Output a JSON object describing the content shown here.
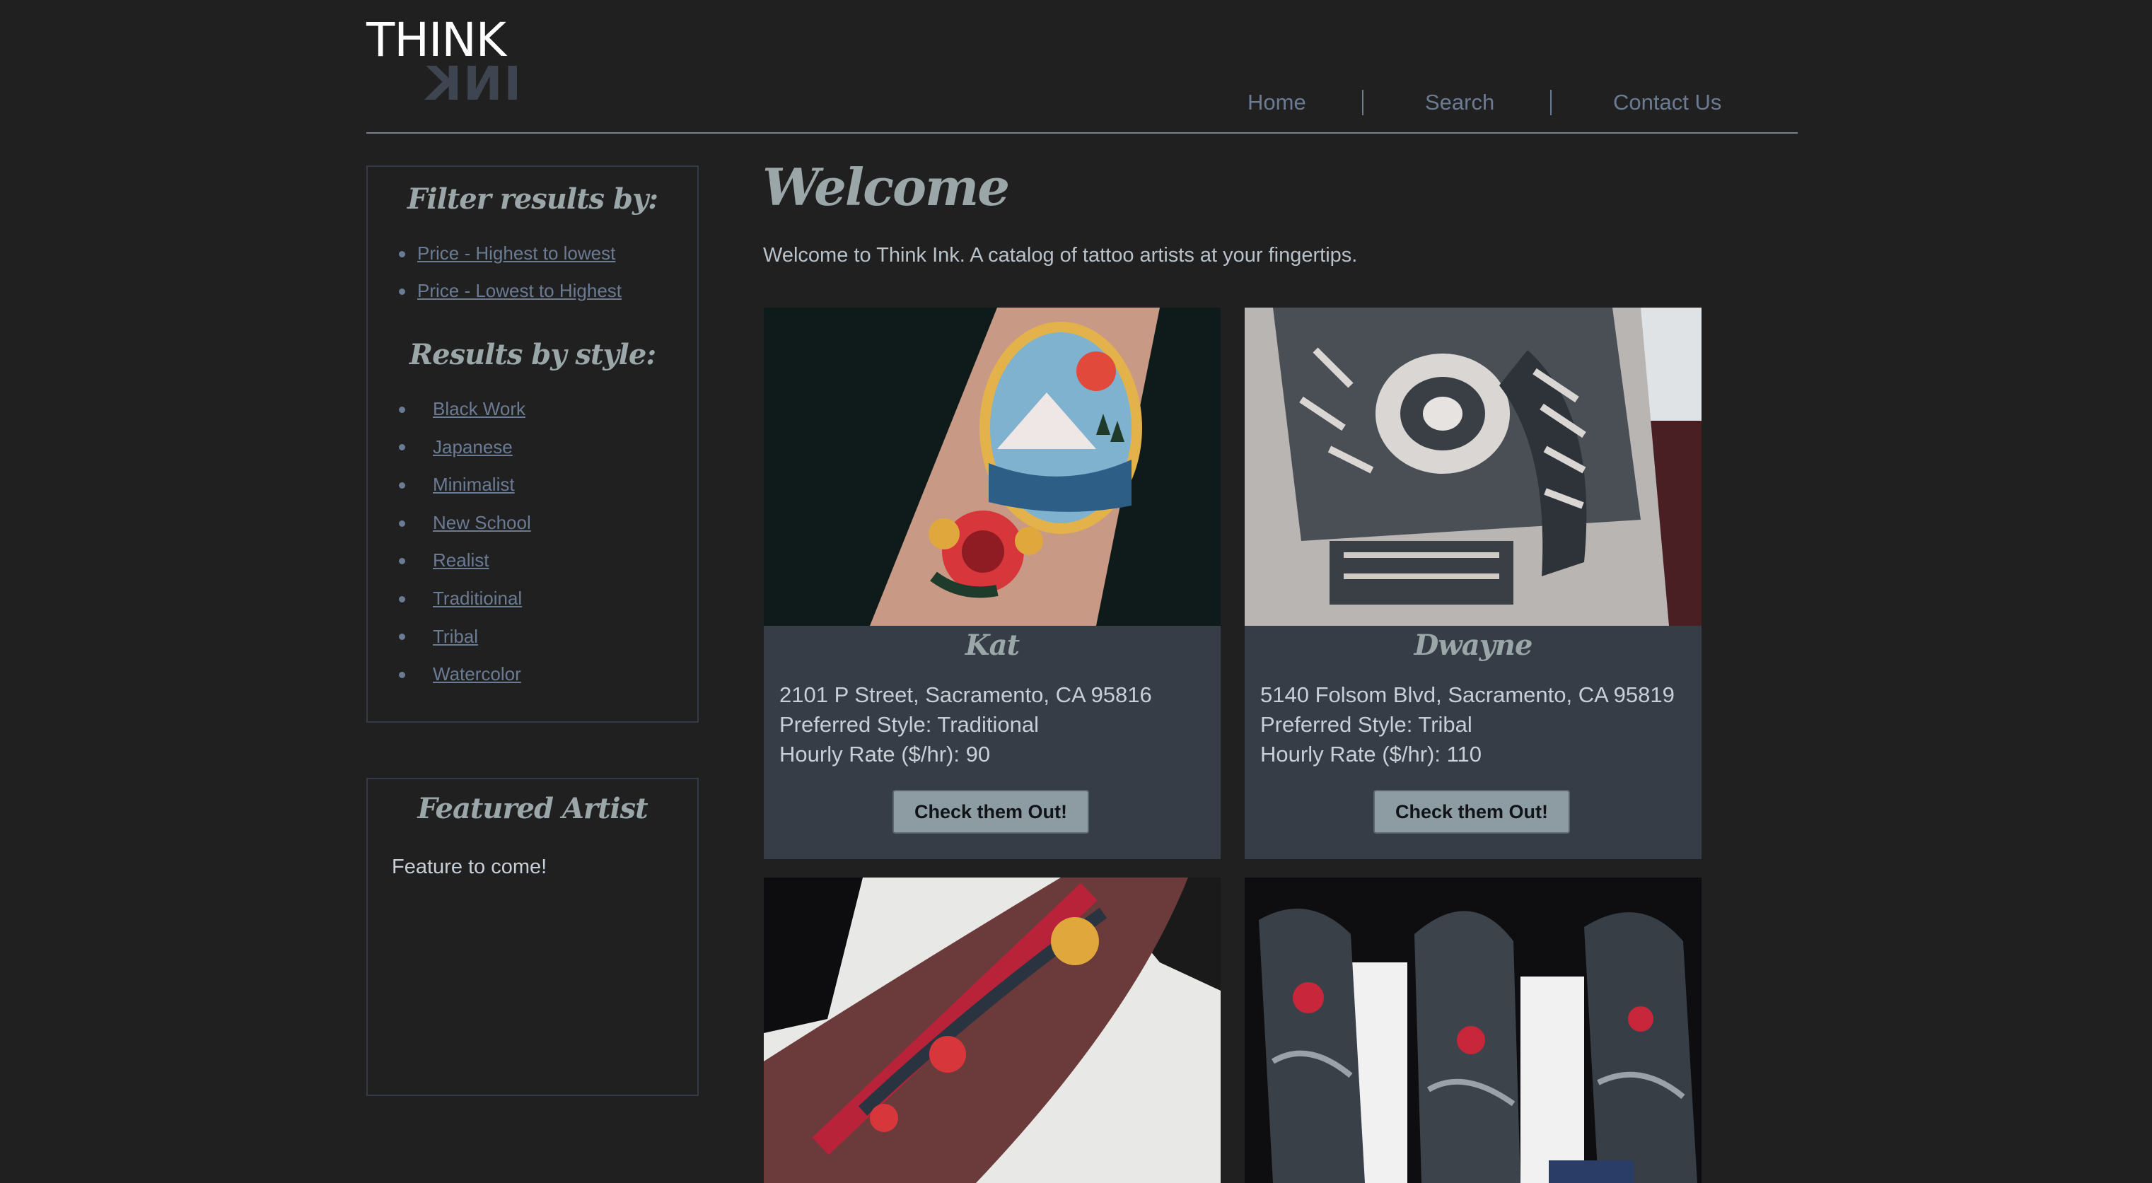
{
  "brand": {
    "think": "THINK",
    "ink": "INK"
  },
  "nav": {
    "home": "Home",
    "search": "Search",
    "contact": "Contact Us"
  },
  "sidebar": {
    "filter_heading": "Filter results by:",
    "sort_options": [
      "Price - Highest to lowest",
      "Price - Lowest to Highest"
    ],
    "style_heading": "Results by style:",
    "styles": [
      "Black Work",
      "Japanese",
      "Minimalist",
      "New School",
      "Realist",
      "Traditioinal",
      "Tribal",
      "Watercolor"
    ],
    "featured_heading": "Featured Artist",
    "featured_text": "Feature to come!"
  },
  "main": {
    "title": "Welcome",
    "intro": "Welcome to Think Ink. A catalog of tattoo artists at your fingertips."
  },
  "artists": [
    {
      "name": "Kat",
      "address": "2101 P Street, Sacramento, CA 95816",
      "style": "Preferred Style: Traditional",
      "rate": "Hourly Rate ($/hr): 90",
      "button": "Check them Out!"
    },
    {
      "name": "Dwayne",
      "address": "5140 Folsom Blvd, Sacramento, CA 95819",
      "style": "Preferred Style: Tribal",
      "rate": "Hourly Rate ($/hr): 110",
      "button": "Check them Out!"
    }
  ],
  "colors": {
    "background": "#202020",
    "card": "#363d47",
    "link": "#6b7b94",
    "heading": "#9aa6a8",
    "button": "#8d9ba2"
  }
}
